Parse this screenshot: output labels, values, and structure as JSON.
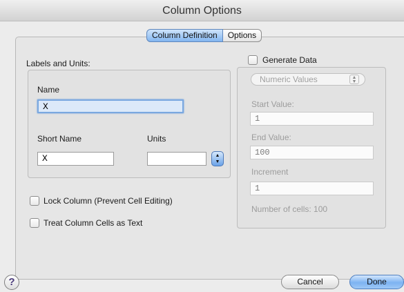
{
  "window": {
    "title": "Column Options"
  },
  "tabs": [
    {
      "label": "Column Definition",
      "active": true
    },
    {
      "label": "Options",
      "active": false
    }
  ],
  "labels_units": {
    "heading": "Labels and Units:",
    "name_label": "Name",
    "name_value": "X",
    "short_name_label": "Short Name",
    "short_name_value": "X",
    "units_label": "Units",
    "units_value": ""
  },
  "lock_column": {
    "label": "Lock Column (Prevent Cell Editing)",
    "checked": false
  },
  "treat_text": {
    "label": "Treat Column Cells as Text",
    "checked": false
  },
  "generate": {
    "label": "Generate Data",
    "checked": false,
    "mode": "Numeric Values",
    "start_label": "Start Value:",
    "start_value": "1",
    "end_label": "End Value:",
    "end_value": "100",
    "increment_label": "Increment",
    "increment_value": "1",
    "cells_text": "Number of cells: 100"
  },
  "buttons": {
    "help": "?",
    "cancel": "Cancel",
    "done": "Done"
  },
  "colors": {
    "accent": "#7db3f2",
    "focus": "#7aa8e0"
  }
}
